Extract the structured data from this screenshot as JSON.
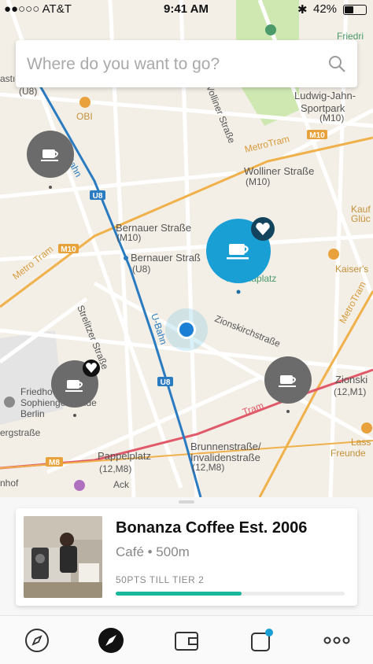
{
  "status_bar": {
    "carrier": "●●○○○ AT&T",
    "time": "9:41 AM",
    "battery": "42%"
  },
  "search": {
    "placeholder": "Where do you want to go?",
    "icon": "search-icon"
  },
  "map": {
    "labels": {
      "u8_station": "(U8)",
      "obi": "OBI",
      "friedrich": "Friedri",
      "ludwig": "Ludwig-Jahn-",
      "sportpark": "Sportpark",
      "m10_a": "(M10)",
      "m10_road": "M10",
      "wolliner": "Wolliner Straße",
      "wolliner_m10": "(M10)",
      "wolliner_road": "Wolliner Straße",
      "metrotram_top": "MetroTram",
      "metrotram_left": "Metro Tram",
      "metrotram_right": "MetroTram",
      "metrotram_bottom": "Tram",
      "ubahn1": "U-Bahn",
      "ubahn2": "U-Bahn",
      "u8_badge1": "U8",
      "u8_badge2": "U8",
      "bernauer1": "Bernauer Straße",
      "bernauer1_sub": "(M10)",
      "bernauer2": "Bernauer Straß",
      "bernauer2_sub": "(U8)",
      "m10_badge": "M10",
      "m8_badge": "M8",
      "kaufland": "Kauf",
      "kaufland2": "Glüc",
      "kaisers": "Kaiser's",
      "arkonaplatz": "Arkonaplatz",
      "zionskirch": "Zionskirchstraße",
      "strelitzer": "Strelitzer Straße",
      "zions_right": "Zionski",
      "zions_right_sub": "(12,M1)",
      "friedhof": "Friedho",
      "sophien": "Sophiengemeinde",
      "berlin": "Berlin",
      "bergstr": "ergstraße",
      "brunnen": "Brunnenstraße/",
      "invaliden": "Invalidenstraße",
      "brunnen_sub": "(12,M8)",
      "pappel": "Pappelplatz",
      "pappel_sub": "(12,M8)",
      "bahnhof": "nhof",
      "lass": "Lass",
      "freunde": "Freunde",
      "m1_badge": "M1",
      "ack": "Ack",
      "stoc": "astı",
      "zionsk": "Zions",
      "right_top1": "Zion",
      "right_top2": "(12",
      "vollm": "Volliner Straße"
    }
  },
  "selected_place": {
    "name": "Bonanza Coffee Est. 2006",
    "meta": "Café • 500m",
    "tier": "50PTS TILL TIER 2",
    "progress": 0.55
  },
  "tabs": [
    {
      "name": "explore",
      "icon": "compass-outline-icon"
    },
    {
      "name": "map",
      "icon": "compass-filled-icon"
    },
    {
      "name": "wallet",
      "icon": "wallet-icon"
    },
    {
      "name": "activity",
      "icon": "notification-square-icon"
    },
    {
      "name": "more",
      "icon": "more-dots-icon"
    }
  ],
  "colors": {
    "accent": "#1a9fd5",
    "progress": "#19b89c",
    "pin_gray": "#6b6b6b",
    "ubahn": "#2a7bc0",
    "tram": "#e8a23b",
    "tram_red": "#e05a6a"
  }
}
